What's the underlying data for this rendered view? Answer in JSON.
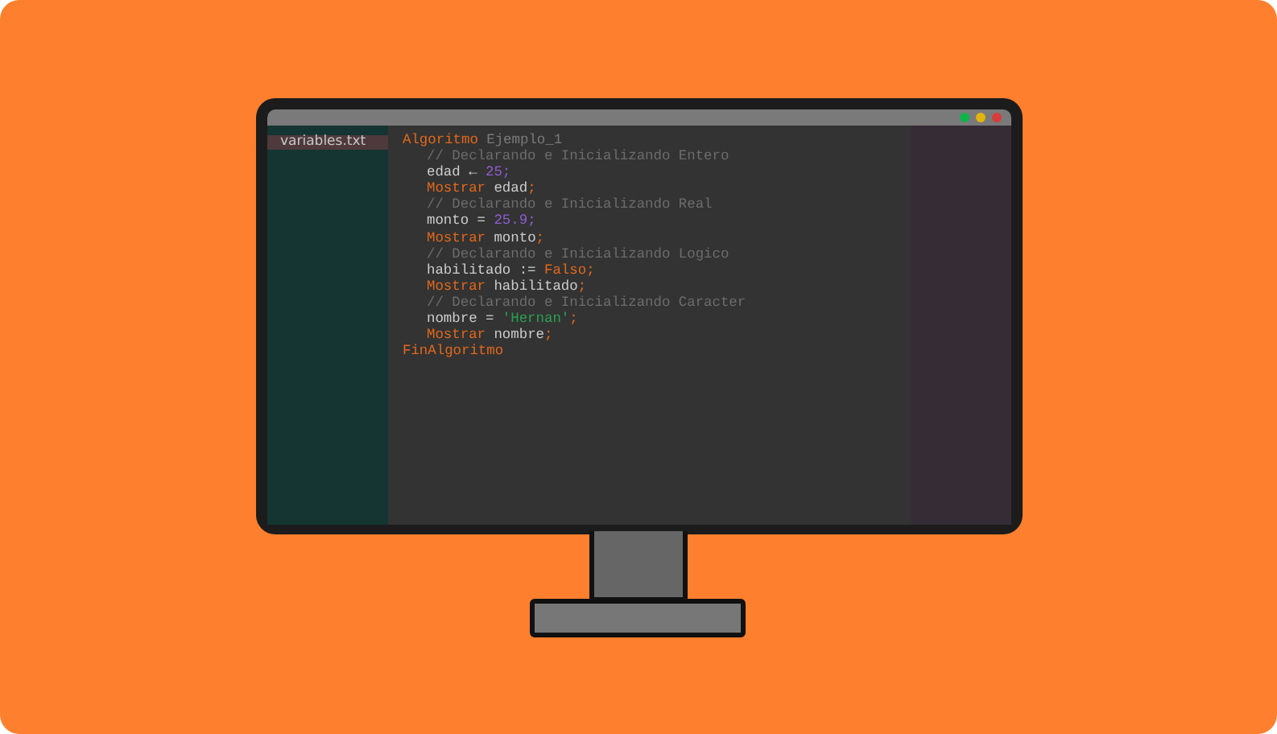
{
  "sidebar": {
    "files": [
      {
        "label": "variables.txt",
        "selected": true
      }
    ]
  },
  "editor": {
    "lines": [
      {
        "tokens": [
          {
            "kind": "keyword",
            "text": "Algoritmo"
          },
          {
            "kind": "name",
            "text": " Ejemplo_1"
          }
        ],
        "children": [
          {
            "tokens": [
              {
                "kind": "comment",
                "text": "// Declarando e Inicializando Entero"
              }
            ]
          },
          {
            "tokens": [
              {
                "kind": "plain",
                "text": "edad ← "
              },
              {
                "kind": "number",
                "text": "25;"
              }
            ]
          },
          {
            "tokens": [
              {
                "kind": "keyword",
                "text": "Mostrar"
              },
              {
                "kind": "plain",
                "text": " edad"
              },
              {
                "kind": "keyword",
                "text": ";"
              }
            ]
          },
          {
            "tokens": [
              {
                "kind": "comment",
                "text": "// Declarando e Inicializando Real"
              }
            ]
          },
          {
            "tokens": [
              {
                "kind": "plain",
                "text": "monto = "
              },
              {
                "kind": "number",
                "text": "25.9;"
              }
            ]
          },
          {
            "tokens": [
              {
                "kind": "keyword",
                "text": "Mostrar"
              },
              {
                "kind": "plain",
                "text": " monto"
              },
              {
                "kind": "keyword",
                "text": ";"
              }
            ]
          },
          {
            "tokens": [
              {
                "kind": "comment",
                "text": "// Declarando e Inicializando Logico"
              }
            ]
          },
          {
            "tokens": [
              {
                "kind": "plain",
                "text": "habilitado := "
              },
              {
                "kind": "keyword",
                "text": "Falso;"
              }
            ]
          },
          {
            "tokens": [
              {
                "kind": "keyword",
                "text": "Mostrar"
              },
              {
                "kind": "plain",
                "text": " habilitado"
              },
              {
                "kind": "keyword",
                "text": ";"
              }
            ]
          },
          {
            "tokens": [
              {
                "kind": "comment",
                "text": "// Declarando e Inicializando Caracter"
              }
            ]
          },
          {
            "tokens": [
              {
                "kind": "plain",
                "text": "nombre = "
              },
              {
                "kind": "string",
                "text": "'Hernan'"
              },
              {
                "kind": "keyword",
                "text": ";"
              }
            ]
          },
          {
            "tokens": [
              {
                "kind": "keyword",
                "text": "Mostrar"
              },
              {
                "kind": "plain",
                "text": " nombre"
              },
              {
                "kind": "keyword",
                "text": ";"
              }
            ]
          }
        ]
      },
      {
        "tokens": [
          {
            "kind": "keyword",
            "text": "FinAlgoritmo"
          }
        ]
      }
    ]
  }
}
